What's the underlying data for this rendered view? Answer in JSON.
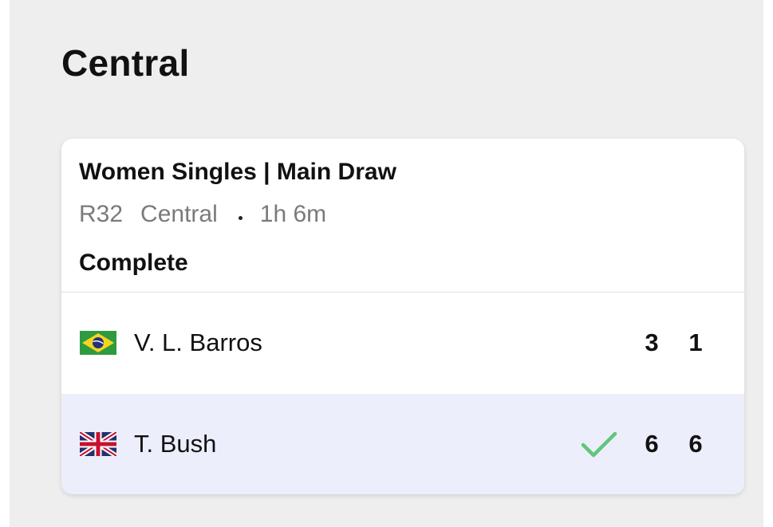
{
  "court": {
    "title": "Central"
  },
  "match": {
    "event": "Women Singles | Main Draw",
    "round": "R32",
    "court": "Central",
    "duration": "1h 6m",
    "status": "Complete",
    "players": [
      {
        "name": "V. L. Barros",
        "flag": "brazil-flag-icon",
        "sets": [
          "3",
          "1"
        ],
        "winner": false
      },
      {
        "name": "T. Bush",
        "flag": "uk-flag-icon",
        "sets": [
          "6",
          "6"
        ],
        "winner": true
      }
    ]
  },
  "colors": {
    "panel_bg": "#eeeeee",
    "card_bg": "#ffffff",
    "winner_row_bg": "#eceefb",
    "winner_check": "#5fc77a",
    "muted_text": "#7a7a7a"
  }
}
